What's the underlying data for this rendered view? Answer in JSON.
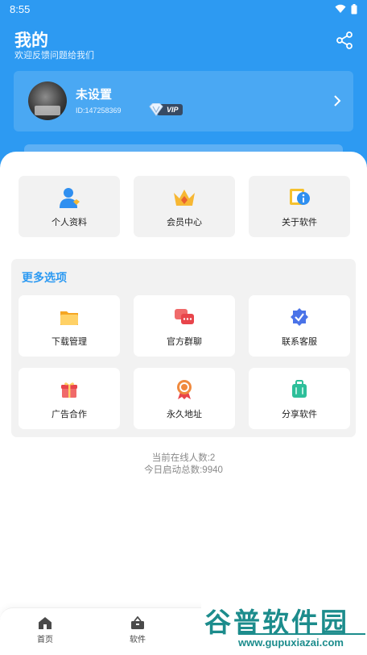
{
  "status_bar": {
    "time": "8:55"
  },
  "header": {
    "title": "我的",
    "subtitle": "欢迎反馈问题给我们"
  },
  "profile": {
    "name": "未设置",
    "id_text": "ID:147258369",
    "vip_label": "VIP"
  },
  "top_tiles": [
    {
      "label": "个人资料",
      "icon": "user-icon"
    },
    {
      "label": "会员中心",
      "icon": "crown-icon"
    },
    {
      "label": "关于软件",
      "icon": "info-icon"
    }
  ],
  "more": {
    "title": "更多选项",
    "items": [
      {
        "label": "下载管理",
        "icon": "folder-icon"
      },
      {
        "label": "官方群聊",
        "icon": "chat-icon"
      },
      {
        "label": "联系客服",
        "icon": "support-badge-icon"
      },
      {
        "label": "广告合作",
        "icon": "gift-icon"
      },
      {
        "label": "永久地址",
        "icon": "medal-icon"
      },
      {
        "label": "分享软件",
        "icon": "suitcase-icon"
      }
    ]
  },
  "stats": {
    "online": "当前在线人数:2",
    "launches": "今日启动总数:9940"
  },
  "tabbar": {
    "items": [
      {
        "label": "首页"
      },
      {
        "label": "软件"
      }
    ]
  },
  "watermark": {
    "brand": "谷普软件园",
    "url": "www.gupuxiazai.com"
  },
  "colors": {
    "primary": "#2d9af2",
    "panel": "#f2f2f2",
    "watermark": "#1c8c8c"
  }
}
